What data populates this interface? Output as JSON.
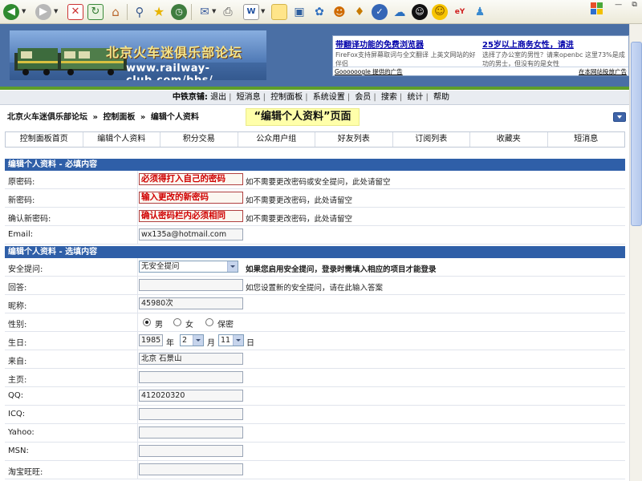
{
  "browser": {
    "toolbar_icons": [
      "back-icon",
      "forward-icon",
      "stop-icon",
      "refresh-icon",
      "home-icon",
      "search-icon",
      "favorites-icon",
      "history-icon",
      "mail-icon",
      "print-icon",
      "edit-icon",
      "note-icon",
      "messenger-icon",
      "discuss-icon",
      "emoticon-icon",
      "bag-icon",
      "info-icon",
      "blog-icon",
      "qq-icon",
      "smiley-icon",
      "ebay-icon",
      "msn-icon"
    ],
    "window_controls": [
      "—",
      "⧉"
    ]
  },
  "header": {
    "site_title": "北京火车迷俱乐部论坛",
    "site_url": "www.railway-club.com/bbs/",
    "ads": [
      {
        "title": "带翻译功能的免费浏览器",
        "text": "FireFox支持屏幕取词与全文翻译 上英文网站的好伴侣"
      },
      {
        "title": "25岁以上商务女性，请进",
        "text": "选择了办公室的男性？请来openbc 这里73%是成功的男士，但没有的是女性"
      }
    ],
    "ad_footer_left": "Goooooogle 提供的广告",
    "ad_footer_right": "在本网站投放广告"
  },
  "topnav": {
    "user_prefix": "中铁京铺:",
    "items": [
      "退出",
      "短消息",
      "控制面板",
      "系统设置",
      "会员",
      "搜索",
      "统计",
      "帮助"
    ]
  },
  "breadcrumb": [
    "北京火车迷俱乐部论坛",
    "控制面板",
    "编辑个人资料"
  ],
  "breadcrumb_sep": "»",
  "page_title": "“编辑个人资料”页面",
  "tabs": [
    "控制面板首页",
    "编辑个人资料",
    "积分交易",
    "公众用户组",
    "好友列表",
    "订阅列表",
    "收藏夹",
    "短消息"
  ],
  "required_section": {
    "title": "编辑个人资料 - 必填内容",
    "rows": [
      {
        "label": "原密码:",
        "value": "必须得打入自己的密码",
        "note": "如不需要更改密码或安全提问，此处请留空"
      },
      {
        "label": "新密码:",
        "value": "输入更改的新密码",
        "note": "如不需要更改密码，此处请留空"
      },
      {
        "label": "确认新密码:",
        "value": "确认密码栏内必须相同",
        "note": "如不需要更改密码，此处请留空"
      },
      {
        "label": "Email:",
        "value": "wx135a@hotmail.com",
        "note": ""
      }
    ]
  },
  "optional_section": {
    "title": "编辑个人资料 - 选填内容",
    "security_question": {
      "label": "安全提问:",
      "selected": "无安全提问",
      "note": "如果您启用安全提问，登录时需填入相应的项目才能登录"
    },
    "answer": {
      "label": "回答:",
      "value": "",
      "note": "如您设置新的安全提问，请在此输入答案"
    },
    "nickname": {
      "label": "昵称:",
      "value": "45980次"
    },
    "gender": {
      "label": "性别:",
      "options": [
        "男",
        "女",
        "保密"
      ],
      "selected": "男"
    },
    "birthday": {
      "label": "生日:",
      "year": "1985",
      "year_unit": "年",
      "month": "2",
      "month_unit": "月",
      "day": "11",
      "day_unit": "日"
    },
    "from": {
      "label": "来自:",
      "value": "北京 石景山"
    },
    "homepage": {
      "label": "主页:",
      "value": ""
    },
    "qq": {
      "label": "QQ:",
      "value": "412020320"
    },
    "icq": {
      "label": "ICQ:",
      "value": ""
    },
    "yahoo": {
      "label": "Yahoo:",
      "value": ""
    },
    "msn": {
      "label": "MSN:",
      "value": ""
    },
    "taobao": {
      "label": "淘宝旺旺:",
      "value": ""
    }
  }
}
